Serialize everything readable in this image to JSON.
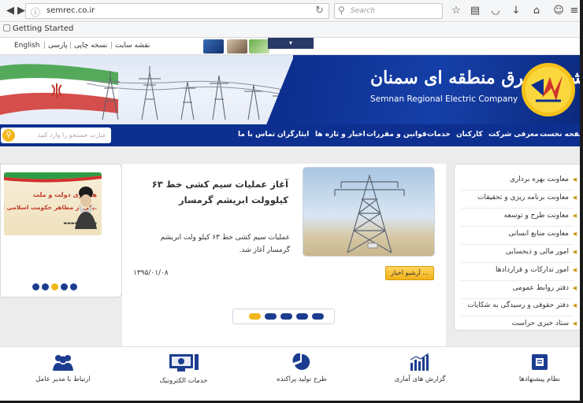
{
  "browser": {
    "url": "semrec.co.ir",
    "search_placeholder": "Search",
    "bookmark": "Getting Started"
  },
  "header_links": {
    "english": "English",
    "persian": "پارسی",
    "print": "نسخه چاپی",
    "sitemap": "نقشه سایت"
  },
  "company": {
    "name_fa": "شرکت برق منطقه ای سمنان",
    "name_en": "Semnan Regional Electric Company"
  },
  "nav": {
    "items": [
      "صفحه نخست",
      "معرفی شرکت",
      "کارکنان",
      "خدمات",
      "قوانین و مقررات",
      "اخبار و تازه ها",
      "ایثارگران",
      "تماس با ما"
    ],
    "search_placeholder": "عبارت جستجو را وارد کنید"
  },
  "poster": {
    "line1": "همکاری دولت و ملت",
    "line2": "یکی از مظاهر حکومت اسلامی است."
  },
  "news": {
    "title": "آغاز عملیات سیم کشی خط ۶۳ کیلوولت ابریشم گرمسار",
    "body": "عملیات سیم کشی خط ۶۳ کیلو ولت ابریشم گرمسار آغاز شد.",
    "date": "۱۳۹۵/۰۱/۰۸",
    "archive_label": "آرشیو اخبار ..."
  },
  "menu": [
    "معاونت بهره برداری",
    "معاونت برنامه ریزی و تحقیقات",
    "معاونت طرح و توسعه",
    "معاونت منابع انسانی",
    "امور مالی و ذیحسابی",
    "امور تدارکات و قراردادها",
    "دفتر روابط عمومی",
    "دفتر حقوقی و رسیدگی به شکایات",
    "ستاد خبری حراست"
  ],
  "footer": {
    "suggestions": "نظام پیشنهادها",
    "stats": "گزارش های آماری",
    "production": "طرح تولید پراکنده",
    "eservices": "خدمات الکترونیک",
    "ceo": "ارتباط با مدیر عامل"
  },
  "colors": {
    "brand_blue": "#0d2f8f",
    "accent_yellow": "#f2b71c"
  }
}
